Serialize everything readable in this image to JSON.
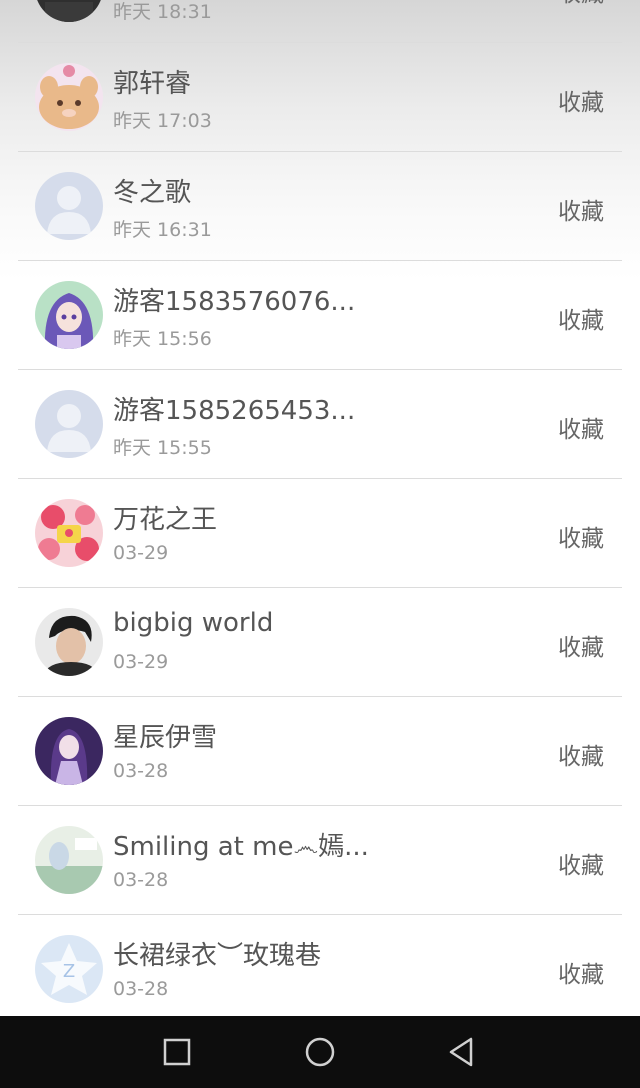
{
  "action_label": "收藏",
  "rows": [
    {
      "name": "",
      "time": "昨天 18:31",
      "avatar": "dark-photo-avatar-icon"
    },
    {
      "name": "郭轩睿",
      "time": "昨天 17:03",
      "avatar": "cartoon-pig-avatar-icon"
    },
    {
      "name": "冬之歌",
      "time": "昨天 16:31",
      "avatar": "default-person-avatar-icon"
    },
    {
      "name": "游客1583576076...",
      "time": "昨天 15:56",
      "avatar": "anime-girl-avatar-icon"
    },
    {
      "name": "游客1585265453...",
      "time": "昨天 15:55",
      "avatar": "default-person-avatar-icon"
    },
    {
      "name": "万花之王",
      "time": "03-29",
      "avatar": "pink-flower-avatar-icon"
    },
    {
      "name": "bigbig world",
      "time": "03-29",
      "avatar": "man-photo-avatar-icon"
    },
    {
      "name": "星辰伊雪",
      "time": "03-28",
      "avatar": "purple-anime-avatar-icon"
    },
    {
      "name": "Smiling at me෴嫣...",
      "time": "03-28",
      "avatar": "light-photo-avatar-icon"
    },
    {
      "name": "长裙绿衣︶玫瑰巷",
      "time": "03-28",
      "avatar": "qzone-star-avatar-icon"
    }
  ],
  "nav": {
    "recent_icon": "square-recent-apps-icon",
    "home_icon": "circle-home-icon",
    "back_icon": "triangle-back-icon"
  },
  "colors": {
    "background": "#ffffff",
    "name_text": "#555555",
    "time_text": "#9a9a9a",
    "divider": "#dcdcdc",
    "navbar": "#0d0d0d"
  }
}
